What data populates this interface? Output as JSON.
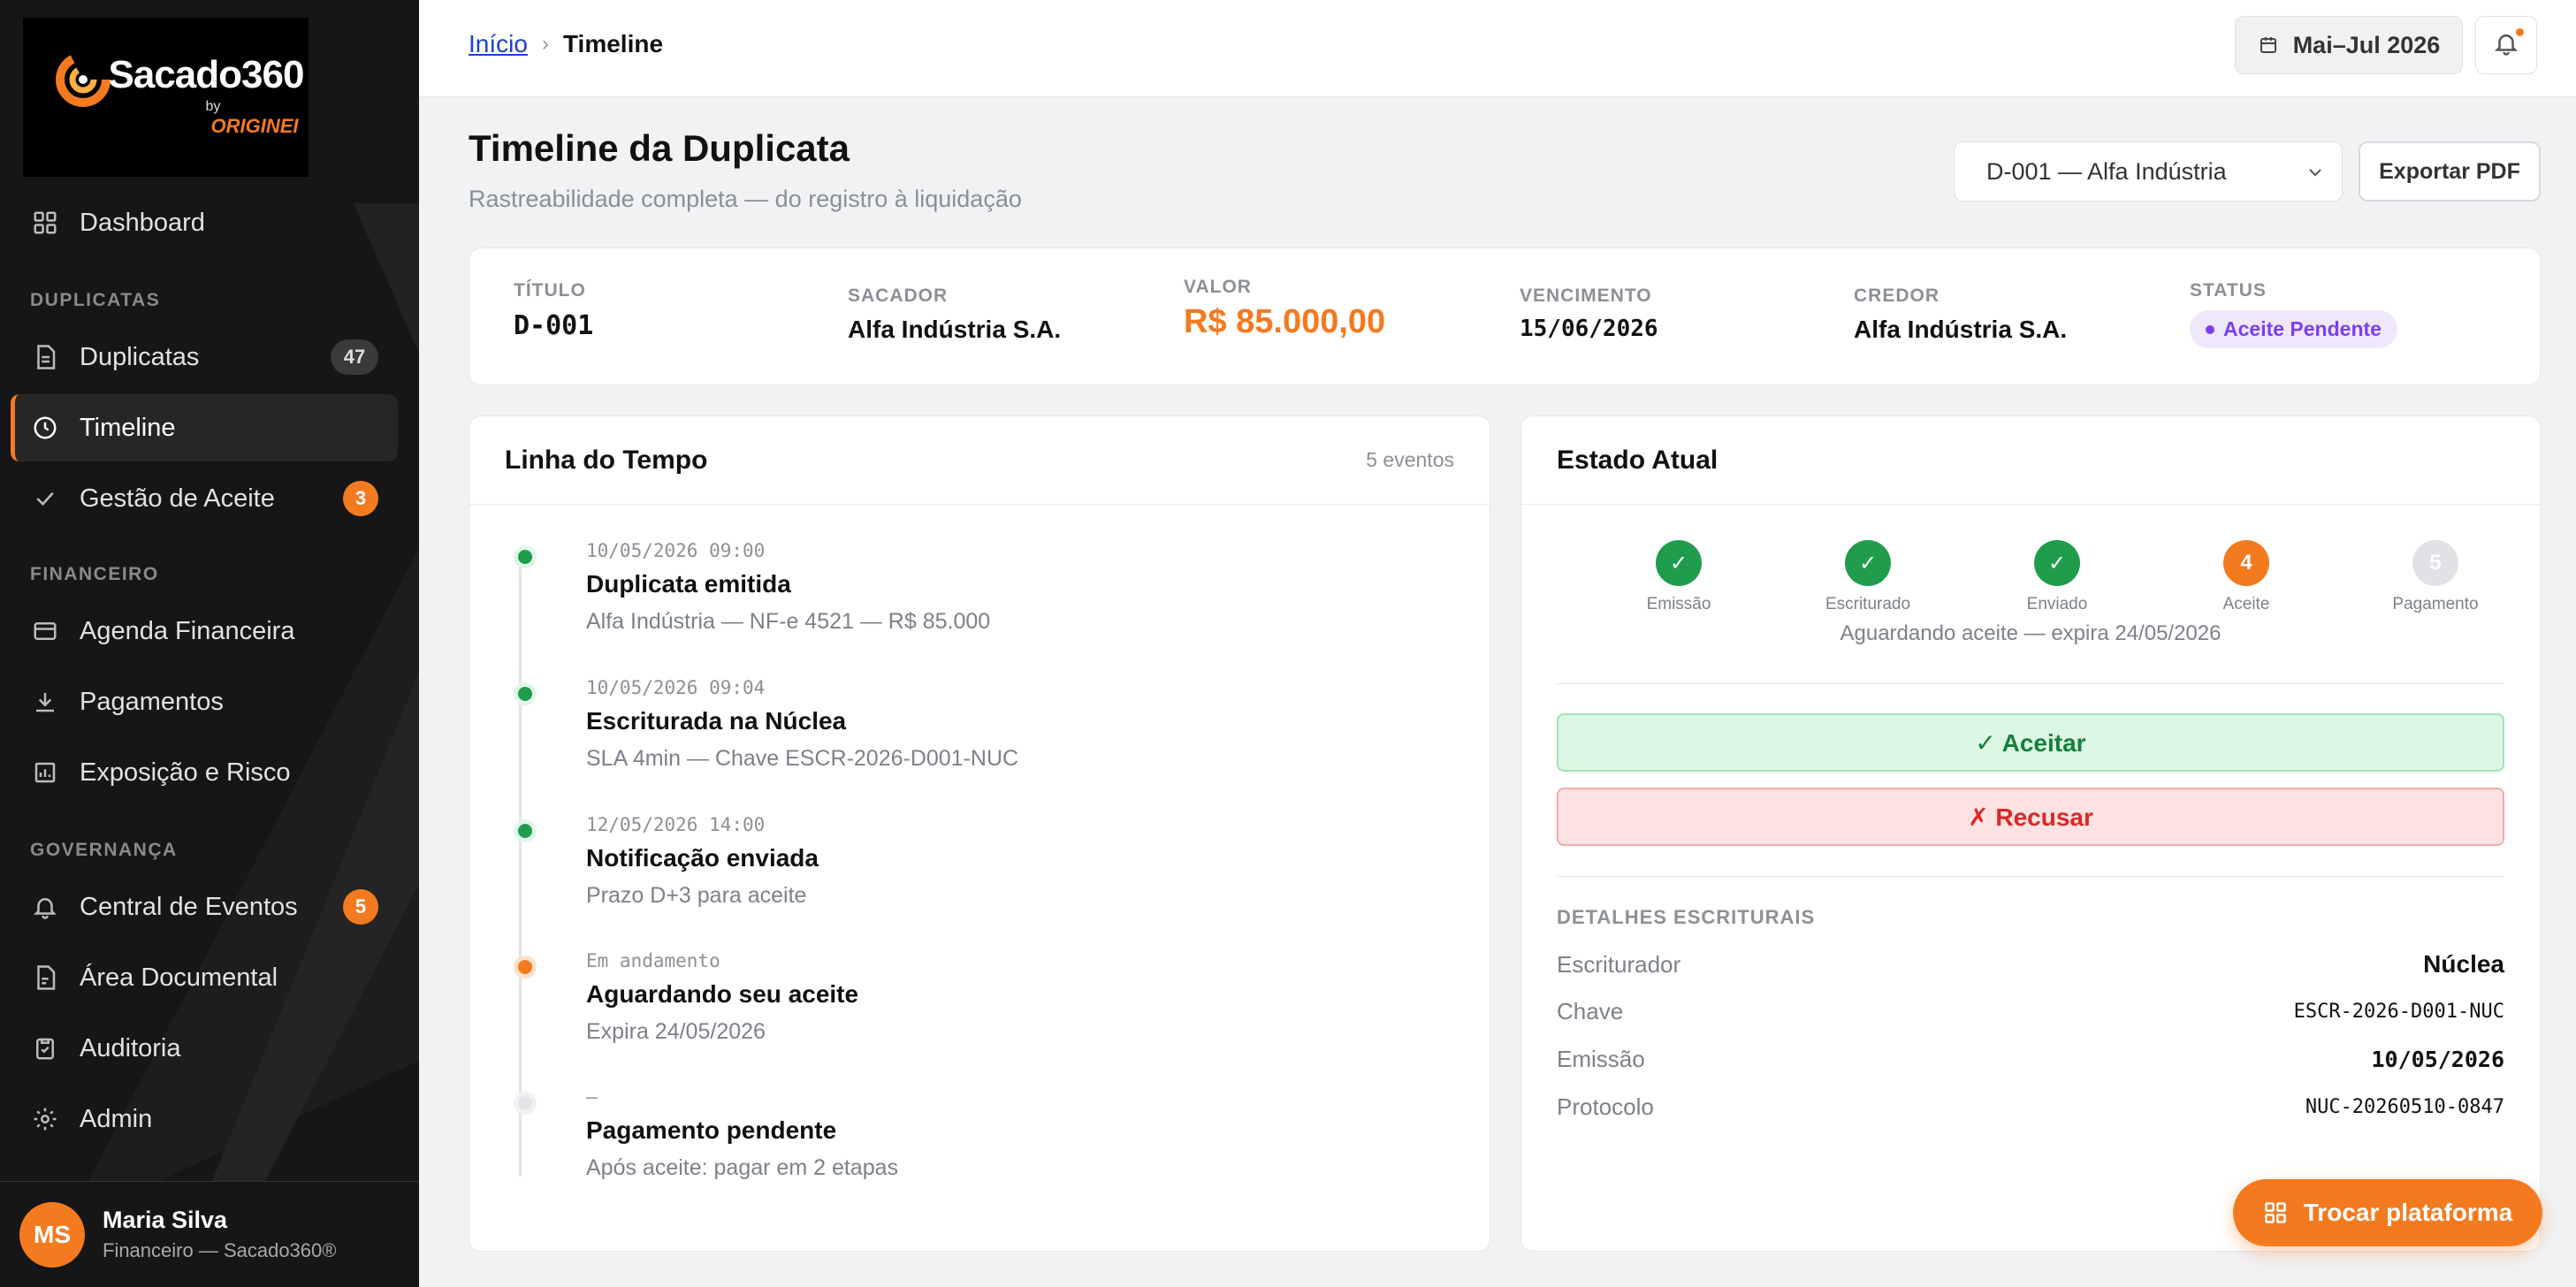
{
  "brand": {
    "name": "Sacado360",
    "by": "by",
    "org": "ORIGINEI"
  },
  "sidebar": {
    "items": [
      {
        "label": "Dashboard",
        "icon": "grid-icon"
      },
      {
        "label": "Duplicatas",
        "icon": "document-icon",
        "badge": "47"
      },
      {
        "label": "Timeline",
        "icon": "clock-icon",
        "active": true
      },
      {
        "label": "Gestão de Aceite",
        "icon": "check-icon",
        "badge": "3"
      },
      {
        "label": "Agenda Financeira",
        "icon": "card-icon"
      },
      {
        "label": "Pagamentos",
        "icon": "download-icon"
      },
      {
        "label": "Exposição e Risco",
        "icon": "bar-chart-icon"
      },
      {
        "label": "Central de Eventos",
        "icon": "bell-icon",
        "badge": "5"
      },
      {
        "label": "Área Documental",
        "icon": "file-icon"
      },
      {
        "label": "Auditoria",
        "icon": "clipboard-icon"
      },
      {
        "label": "Admin",
        "icon": "gear-icon"
      }
    ],
    "sections": [
      "DUPLICATAS",
      "FINANCEIRO",
      "GOVERNANÇA"
    ],
    "user": {
      "initials": "MS",
      "name": "Maria Silva",
      "role": "Financeiro — Sacado360®"
    }
  },
  "topbar": {
    "breadcrumb": {
      "home": "Início",
      "current": "Timeline",
      "separator": "›"
    },
    "period": "Mai–Jul 2026"
  },
  "header": {
    "title": "Timeline da Duplicata",
    "subtitle": "Rastreabilidade completa — do registro à liquidação",
    "select_value": "D-001 — Alfa Indústria",
    "export_label": "Exportar PDF"
  },
  "summary": {
    "titulo_label": "TÍTULO",
    "titulo": "D-001",
    "sacador_label": "SACADOR",
    "sacador": "Alfa Indústria S.A.",
    "valor_label": "VALOR",
    "valor": "R$ 85.000,00",
    "vencimento_label": "VENCIMENTO",
    "vencimento": "15/06/2026",
    "credor_label": "CREDOR",
    "credor": "Alfa Indústria S.A.",
    "status_label": "STATUS",
    "status": "Aceite Pendente"
  },
  "timeline": {
    "title": "Linha do Tempo",
    "count": "5 eventos",
    "events": [
      {
        "time": "10/05/2026 09:00",
        "title": "Duplicata emitida",
        "desc": "Alfa Indústria — NF-e 4521 — R$ 85.000",
        "state": "done"
      },
      {
        "time": "10/05/2026 09:04",
        "title": "Escriturada na Núclea",
        "desc": "SLA 4min — Chave ESCR-2026-D001-NUC",
        "state": "done"
      },
      {
        "time": "12/05/2026 14:00",
        "title": "Notificação enviada",
        "desc": "Prazo D+3 para aceite",
        "state": "done"
      },
      {
        "time": "Em andamento",
        "title": "Aguardando seu aceite",
        "desc": "Expira 24/05/2026",
        "state": "current"
      },
      {
        "time": "—",
        "title": "Pagamento pendente",
        "desc": "Após aceite: pagar em 2 etapas",
        "state": "pending"
      }
    ]
  },
  "state": {
    "title": "Estado Atual",
    "steps": [
      {
        "mark": "✓",
        "label": "Emissão",
        "state": "done"
      },
      {
        "mark": "✓",
        "label": "Escriturado",
        "state": "done"
      },
      {
        "mark": "✓",
        "label": "Enviado",
        "state": "done"
      },
      {
        "mark": "4",
        "label": "Aceite",
        "state": "current"
      },
      {
        "mark": "5",
        "label": "Pagamento",
        "state": "todo"
      }
    ],
    "waiting": "Aguardando aceite — expira 24/05/2026",
    "accept_label": "✓ Aceitar",
    "refuse_label": "✗ Recusar",
    "details_title": "DETALHES ESCRITURAIS",
    "details": [
      {
        "key": "Escriturador",
        "value": "Núclea"
      },
      {
        "key": "Chave",
        "value": "ESCR-2026-D001-NUC"
      },
      {
        "key": "Emissão",
        "value": "10/05/2026"
      },
      {
        "key": "Protocolo",
        "value": "NUC-20260510-0847"
      }
    ]
  },
  "fab": {
    "label": "Trocar plataforma"
  },
  "colors": {
    "accent": "#f47a20",
    "success": "#1f9d4d",
    "danger": "#dc2626",
    "status": "#7b3ff0",
    "sidebar": "#161616"
  }
}
